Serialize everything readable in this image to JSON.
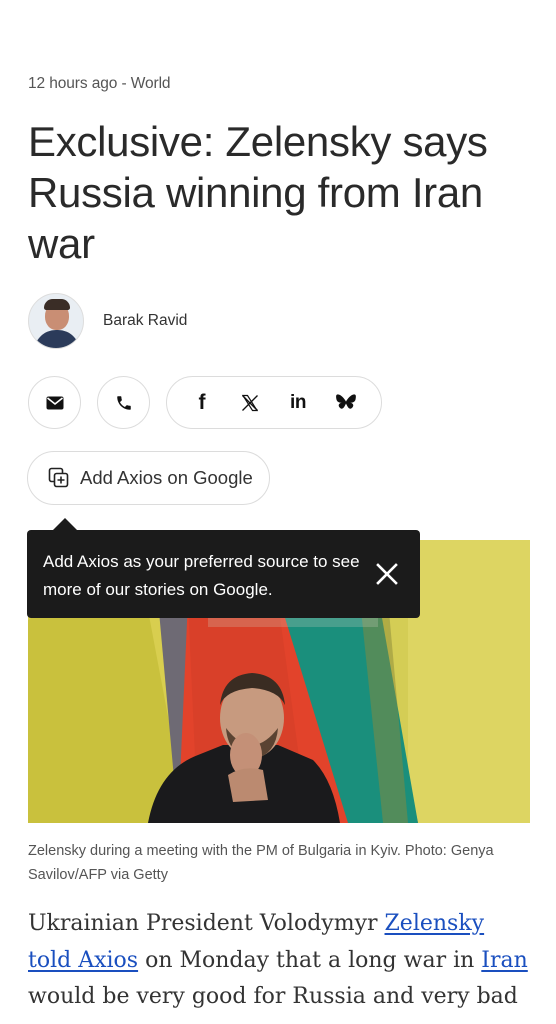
{
  "article": {
    "meta": "12 hours ago - World",
    "headline": "Exclusive: Zelensky says Russia winning from Iran war",
    "author": "Barak Ravid"
  },
  "share": {
    "icons": [
      "email-icon",
      "phone-icon",
      "facebook-icon",
      "x-icon",
      "linkedin-icon",
      "bluesky-icon"
    ],
    "facebook_glyph": "f",
    "linkedin_glyph": "in"
  },
  "google_button": {
    "label": "Add Axios on Google"
  },
  "tooltip": {
    "text": "Add Axios as your preferred source to see more of our stories on Google."
  },
  "photo": {
    "caption": "Zelensky during a meeting with the PM of Bulgaria in Kyiv. Photo: Genya Savilov/AFP via Getty"
  },
  "lead": {
    "t1": "Ukrainian President Volodymyr ",
    "link1": "Zelensky told Axios",
    "t2": " on Monday that a long war in ",
    "link2": "Iran",
    "t3": " would be very good for Russia and very bad"
  },
  "colors": {
    "link": "#1a4fbf",
    "tooltip_bg": "#1b1b1b",
    "text": "#2a2a2a"
  }
}
